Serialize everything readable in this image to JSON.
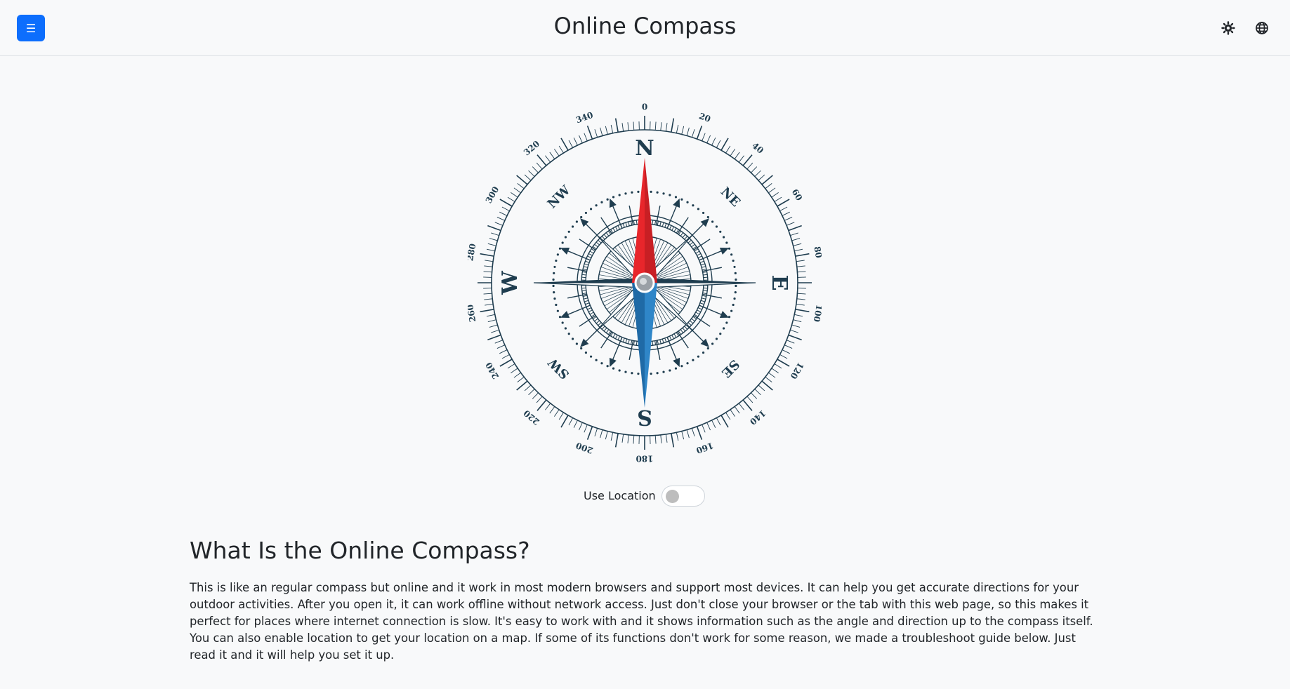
{
  "header": {
    "menu_icon": "☰",
    "title": "Online Compass",
    "theme_icon": "gear-icon",
    "language_icon": "globe-icon"
  },
  "compass": {
    "degree_labels": [
      "0",
      "20",
      "40",
      "60",
      "80",
      "100",
      "120",
      "140",
      "160",
      "180",
      "200",
      "220",
      "240",
      "260",
      "280",
      "300",
      "320",
      "340"
    ],
    "cardinals": {
      "n": "N",
      "e": "E",
      "s": "S",
      "w": "W"
    },
    "intercardinals": {
      "ne": "NE",
      "se": "SE",
      "sw": "SW",
      "nw": "NW"
    },
    "colors": {
      "dial": "#1f3d4f",
      "north_needle": "#e8262b",
      "south_needle": "#2f86c8"
    }
  },
  "location": {
    "label": "Use Location",
    "enabled": false
  },
  "article": {
    "heading": "What Is the Online Compass?",
    "paragraph": "This is like an regular compass but online and it work in most modern browsers and support most devices. It can help you get accurate directions for your outdoor activities. After you open it, it can work offline without network access. Just don't close your browser or the tab with this web page, so this makes it perfect for places where internet connection is slow. It's easy to work with and it shows information such as the angle and direction up to the compass itself. You can also enable location to get your location on a map. If some of its functions don't work for some reason, we made a troubleshoot guide below. Just read it and it will help you set it up."
  }
}
